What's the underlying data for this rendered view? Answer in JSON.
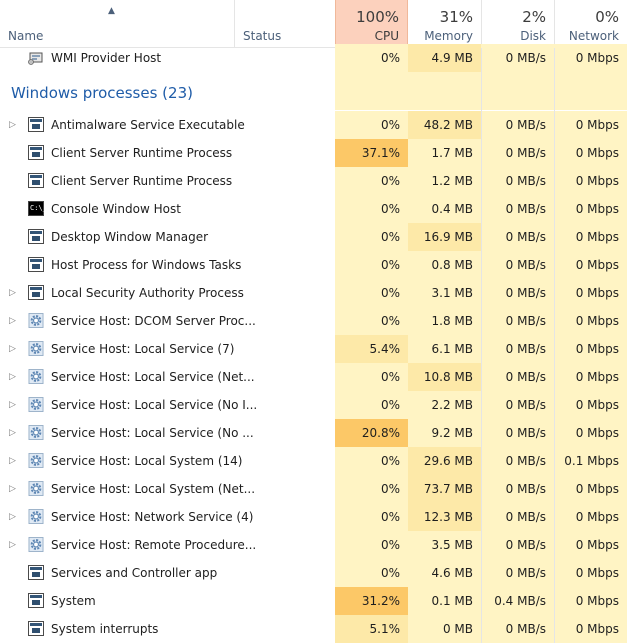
{
  "columns": {
    "name_label": "Name",
    "status_label": "Status",
    "cpu": {
      "pct": "100%",
      "label": "CPU"
    },
    "memory": {
      "pct": "31%",
      "label": "Memory"
    },
    "disk": {
      "pct": "2%",
      "label": "Disk"
    },
    "network": {
      "pct": "0%",
      "label": "Network"
    }
  },
  "top_row": {
    "name": "WMI Provider Host",
    "icon": "wmi-host-icon",
    "cpu": "0%",
    "memory": "4.9 MB",
    "disk": "0 MB/s",
    "network": "0 Mbps"
  },
  "group": {
    "title": "Windows processes (23)"
  },
  "processes": [
    {
      "name": "Antimalware Service Executable",
      "expandable": true,
      "icon": "window-icon",
      "cpu": "0%",
      "memory": "48.2 MB",
      "disk": "0 MB/s",
      "network": "0 Mbps"
    },
    {
      "name": "Client Server Runtime Process",
      "expandable": false,
      "icon": "window-icon",
      "cpu": "37.1%",
      "memory": "1.7 MB",
      "disk": "0 MB/s",
      "network": "0 Mbps"
    },
    {
      "name": "Client Server Runtime Process",
      "expandable": false,
      "icon": "window-icon",
      "cpu": "0%",
      "memory": "1.2 MB",
      "disk": "0 MB/s",
      "network": "0 Mbps"
    },
    {
      "name": "Console Window Host",
      "expandable": false,
      "icon": "console-icon",
      "cpu": "0%",
      "memory": "0.4 MB",
      "disk": "0 MB/s",
      "network": "0 Mbps"
    },
    {
      "name": "Desktop Window Manager",
      "expandable": false,
      "icon": "window-icon",
      "cpu": "0%",
      "memory": "16.9 MB",
      "disk": "0 MB/s",
      "network": "0 Mbps"
    },
    {
      "name": "Host Process for Windows Tasks",
      "expandable": false,
      "icon": "window-icon",
      "cpu": "0%",
      "memory": "0.8 MB",
      "disk": "0 MB/s",
      "network": "0 Mbps"
    },
    {
      "name": "Local Security Authority Process",
      "expandable": true,
      "icon": "window-icon",
      "cpu": "0%",
      "memory": "3.1 MB",
      "disk": "0 MB/s",
      "network": "0 Mbps"
    },
    {
      "name": "Service Host: DCOM Server Proc...",
      "expandable": true,
      "icon": "gear-icon",
      "cpu": "0%",
      "memory": "1.8 MB",
      "disk": "0 MB/s",
      "network": "0 Mbps"
    },
    {
      "name": "Service Host: Local Service (7)",
      "expandable": true,
      "icon": "gear-icon",
      "cpu": "5.4%",
      "memory": "6.1 MB",
      "disk": "0 MB/s",
      "network": "0 Mbps"
    },
    {
      "name": "Service Host: Local Service (Net...",
      "expandable": true,
      "icon": "gear-icon",
      "cpu": "0%",
      "memory": "10.8 MB",
      "disk": "0 MB/s",
      "network": "0 Mbps"
    },
    {
      "name": "Service Host: Local Service (No I...",
      "expandable": true,
      "icon": "gear-icon",
      "cpu": "0%",
      "memory": "2.2 MB",
      "disk": "0 MB/s",
      "network": "0 Mbps"
    },
    {
      "name": "Service Host: Local Service (No ...",
      "expandable": true,
      "icon": "gear-icon",
      "cpu": "20.8%",
      "memory": "9.2 MB",
      "disk": "0 MB/s",
      "network": "0 Mbps"
    },
    {
      "name": "Service Host: Local System (14)",
      "expandable": true,
      "icon": "gear-icon",
      "cpu": "0%",
      "memory": "29.6 MB",
      "disk": "0 MB/s",
      "network": "0.1 Mbps"
    },
    {
      "name": "Service Host: Local System (Net...",
      "expandable": true,
      "icon": "gear-icon",
      "cpu": "0%",
      "memory": "73.7 MB",
      "disk": "0 MB/s",
      "network": "0 Mbps"
    },
    {
      "name": "Service Host: Network Service (4)",
      "expandable": true,
      "icon": "gear-icon",
      "cpu": "0%",
      "memory": "12.3 MB",
      "disk": "0 MB/s",
      "network": "0 Mbps"
    },
    {
      "name": "Service Host: Remote Procedure...",
      "expandable": true,
      "icon": "gear-icon",
      "cpu": "0%",
      "memory": "3.5 MB",
      "disk": "0 MB/s",
      "network": "0 Mbps"
    },
    {
      "name": "Services and Controller app",
      "expandable": false,
      "icon": "window-icon",
      "cpu": "0%",
      "memory": "4.6 MB",
      "disk": "0 MB/s",
      "network": "0 Mbps"
    },
    {
      "name": "System",
      "expandable": false,
      "icon": "window-icon",
      "cpu": "31.2%",
      "memory": "0.1 MB",
      "disk": "0.4 MB/s",
      "network": "0 Mbps"
    },
    {
      "name": "System interrupts",
      "expandable": false,
      "icon": "window-icon",
      "cpu": "5.1%",
      "memory": "0 MB",
      "disk": "0 MB/s",
      "network": "0 Mbps"
    }
  ],
  "colors": {
    "heat_light": "#fff4c4",
    "heat_medium": "#fde9a8",
    "heat_hot": "#fcc867",
    "cpu_header": "#fcd1bd",
    "group_title": "#1f5ca8"
  }
}
